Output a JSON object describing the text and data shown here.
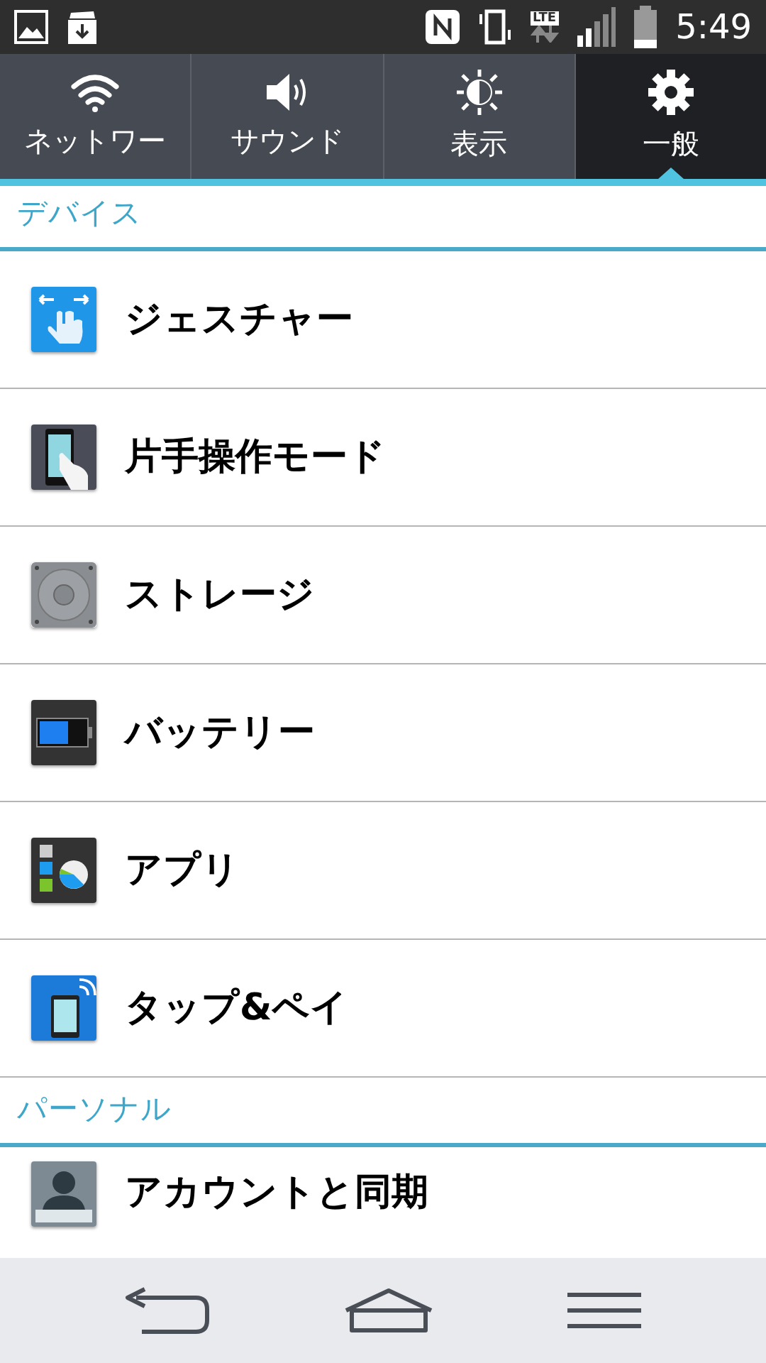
{
  "status_bar": {
    "network": "LTE",
    "time": "5:49"
  },
  "tabs": [
    {
      "kind": "wifi",
      "label": "ネットワー",
      "selected": false
    },
    {
      "kind": "sound",
      "label": "サウンド",
      "selected": false
    },
    {
      "kind": "display",
      "label": "表示",
      "selected": false
    },
    {
      "kind": "general",
      "label": "一般",
      "selected": true
    }
  ],
  "sections": [
    {
      "title": "デバイス",
      "items": [
        {
          "kind": "gesture",
          "label": "ジェスチャー"
        },
        {
          "kind": "onehand",
          "label": "片手操作モード"
        },
        {
          "kind": "storage",
          "label": "ストレージ"
        },
        {
          "kind": "battery",
          "label": "バッテリー"
        },
        {
          "kind": "apps",
          "label": "アプリ"
        },
        {
          "kind": "tappay",
          "label": "タップ&ペイ"
        }
      ]
    },
    {
      "title": "パーソナル",
      "items": [
        {
          "kind": "account",
          "label": "アカウントと同期"
        }
      ]
    }
  ]
}
